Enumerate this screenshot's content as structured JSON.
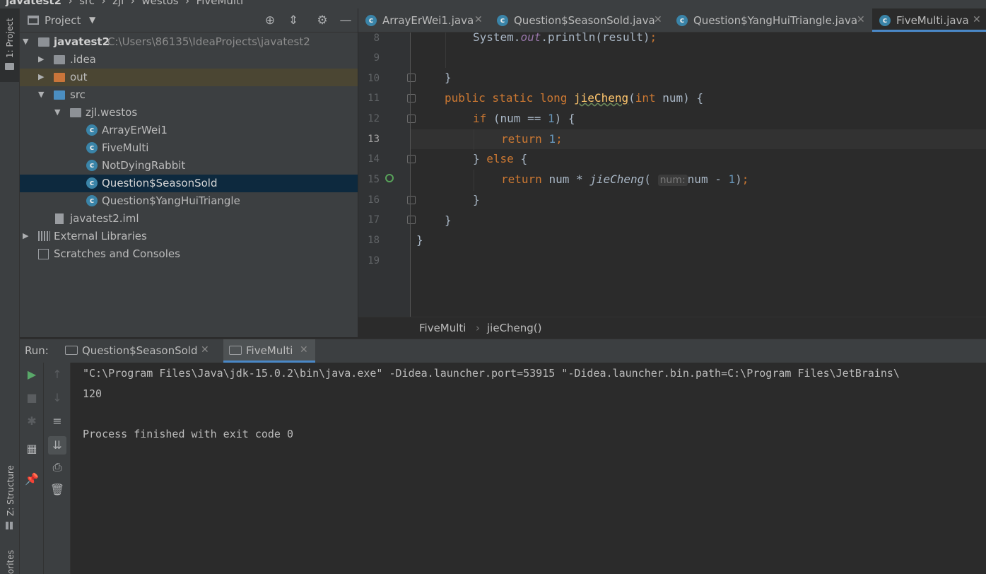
{
  "breadcrumb": {
    "project": "javatest2",
    "items": [
      "src",
      "zjl",
      "westos",
      "FiveMulti"
    ]
  },
  "left_strip": {
    "project_tab": "1: Project",
    "structure_tab": "Z: Structure",
    "favorites_tab": "orites"
  },
  "project_panel": {
    "title": "Project",
    "tree": {
      "root_name": "javatest2",
      "root_path": "C:\\Users\\86135\\IdeaProjects\\javatest2",
      "idea": ".idea",
      "out": "out",
      "src": "src",
      "package": "zjl.westos",
      "classes": [
        "ArrayErWei1",
        "FiveMulti",
        "NotDyingRabbit",
        "Question$SeasonSold",
        "Question$YangHuiTriangle"
      ],
      "selected": "Question$SeasonSold",
      "iml": "javatest2.iml",
      "external": "External Libraries",
      "scratches": "Scratches and Consoles"
    }
  },
  "editor": {
    "tabs": [
      {
        "label": "ArrayErWei1.java",
        "active": false
      },
      {
        "label": "Question$SeasonSold.java",
        "active": false
      },
      {
        "label": "Question$YangHuiTriangle.java",
        "active": false
      },
      {
        "label": "FiveMulti.java",
        "active": true
      }
    ],
    "current_line": 13,
    "line_numbers": [
      "8",
      "9",
      "10",
      "11",
      "12",
      "13",
      "14",
      "15",
      "16",
      "17",
      "18",
      "19"
    ],
    "param_hint": "num:",
    "breadcrumb": {
      "class": "FiveMulti",
      "method": "jieCheng()"
    }
  },
  "run_panel": {
    "label": "Run:",
    "tabs": [
      {
        "label": "Question$SeasonSold",
        "active": false
      },
      {
        "label": "FiveMulti",
        "active": true
      }
    ],
    "console": [
      "\"C:\\Program Files\\Java\\jdk-15.0.2\\bin\\java.exe\" -Didea.launcher.port=53915 \"-Didea.launcher.bin.path=C:\\Program Files\\JetBrains\\",
      "120",
      "",
      "Process finished with exit code 0"
    ]
  },
  "colors": {
    "keyword": "#cc7832",
    "number": "#6897bb",
    "function": "#ffc66d",
    "accent": "#4a88c7",
    "selection": "#0d293e"
  }
}
